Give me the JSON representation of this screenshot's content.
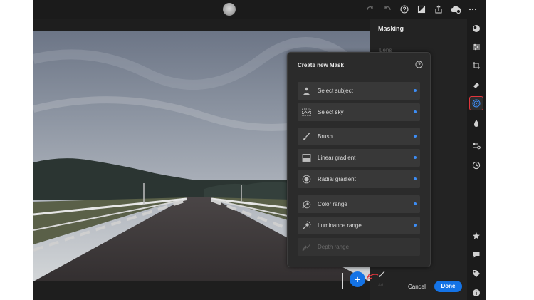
{
  "panel": {
    "title": "Masking",
    "sub_item": "Lens"
  },
  "popup": {
    "title": "Create new Mask",
    "items": [
      {
        "label": "Select subject",
        "icon": "select-subject-icon",
        "has_dot": true,
        "enabled": true
      },
      {
        "label": "Select sky",
        "icon": "select-sky-icon",
        "has_dot": true,
        "enabled": true
      },
      {
        "label": "Brush",
        "icon": "brush-icon",
        "has_dot": true,
        "enabled": true
      },
      {
        "label": "Linear gradient",
        "icon": "linear-gradient-icon",
        "has_dot": true,
        "enabled": true
      },
      {
        "label": "Radial gradient",
        "icon": "radial-gradient-icon",
        "has_dot": true,
        "enabled": true
      },
      {
        "label": "Color range",
        "icon": "color-range-icon",
        "has_dot": true,
        "enabled": true
      },
      {
        "label": "Luminance range",
        "icon": "luminance-range-icon",
        "has_dot": true,
        "enabled": true
      },
      {
        "label": "Depth range",
        "icon": "depth-range-icon",
        "has_dot": false,
        "enabled": false
      }
    ]
  },
  "bottom": {
    "add_symbol": "+",
    "small_label": "Ad",
    "cancel": "Cancel",
    "done": "Done"
  },
  "colors": {
    "accent": "#1473e6",
    "dot": "#3d8df5",
    "highlight": "#e0353c"
  },
  "toolbar_icons": [
    "redo-icon",
    "undo-icon",
    "help-icon",
    "compare-icon",
    "share-icon",
    "cloud-sync-icon",
    "more-icon"
  ],
  "rail_icons": [
    "presets-icon",
    "edit-sliders-icon",
    "crop-icon",
    "healing-icon",
    "masking-icon",
    "geometry-icon",
    "versions-icon",
    "history-icon",
    "rating-icon",
    "comments-icon",
    "tag-icon",
    "info-icon"
  ]
}
